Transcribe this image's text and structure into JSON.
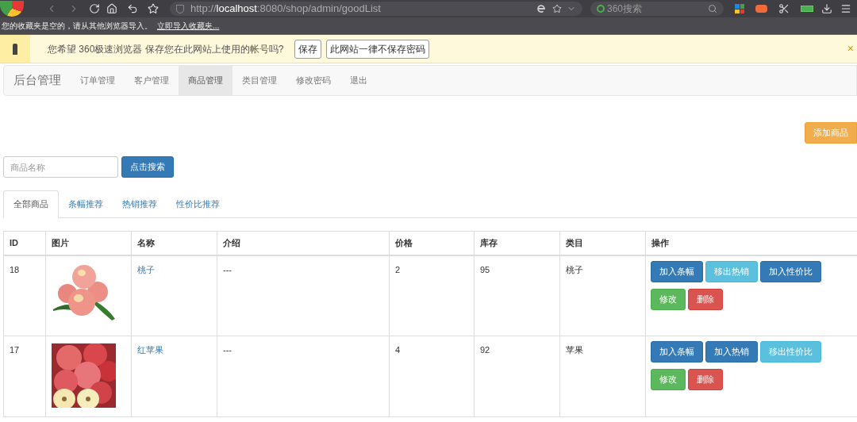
{
  "browser": {
    "url_scheme": "http://",
    "url_host": "localhost",
    "url_rest": ":8080/shop/admin/goodList",
    "search_placeholder": "360搜索",
    "bookmarks_text": "您的收藏夹是空的，请从其他浏览器导入。",
    "bookmarks_link": "立即导入收藏夹..."
  },
  "password_bar": {
    "message": "您希望 360极速浏览器 保存您在此网站上使用的帐号吗?",
    "buttons": [
      "保存",
      "此网站一律不保存密码"
    ],
    "close": "×"
  },
  "navbar": {
    "brand": "后台管理",
    "items": [
      {
        "label": "订单管理",
        "selected": false
      },
      {
        "label": "客户管理",
        "selected": false
      },
      {
        "label": "商品管理",
        "selected": true
      },
      {
        "label": "类目管理",
        "selected": false
      },
      {
        "label": "修改密码",
        "selected": false
      },
      {
        "label": "退出",
        "selected": false
      }
    ]
  },
  "add_button": "添加商品",
  "search": {
    "placeholder": "商品名称",
    "button": "点击搜索"
  },
  "tabs": [
    {
      "label": "全部商品",
      "selected": true
    },
    {
      "label": "条幅推荐",
      "selected": false
    },
    {
      "label": "热销推荐",
      "selected": false
    },
    {
      "label": "性价比推荐",
      "selected": false
    }
  ],
  "table": {
    "columns": [
      "ID",
      "图片",
      "名称",
      "介绍",
      "价格",
      "库存",
      "类目",
      "操作"
    ],
    "rows": [
      {
        "id": "18",
        "picture": {
          "kind": "picture"
        },
        "name": "桃子",
        "intro": "---",
        "price": "2",
        "stock": "95",
        "category": "桃子",
        "actions": [
          {
            "label": "加入条幅",
            "kind": "primary"
          },
          {
            "label": "移出热销",
            "kind": "info"
          },
          {
            "label": "加入性价比",
            "kind": "primary"
          },
          {
            "label": "修改",
            "kind": "success"
          },
          {
            "label": "删除",
            "kind": "danger"
          }
        ]
      },
      {
        "id": "17",
        "picture": {
          "kind": "picture"
        },
        "name": "红苹果",
        "intro": "---",
        "price": "4",
        "stock": "92",
        "category": "苹果",
        "actions": [
          {
            "label": "加入条幅",
            "kind": "primary"
          },
          {
            "label": "加入热销",
            "kind": "primary"
          },
          {
            "label": "移出性价比",
            "kind": "info"
          },
          {
            "label": "修改",
            "kind": "success"
          },
          {
            "label": "删除",
            "kind": "danger"
          }
        ]
      }
    ]
  }
}
